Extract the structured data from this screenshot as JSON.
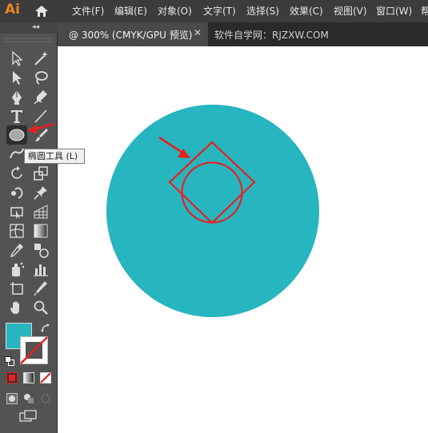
{
  "app": {
    "logo": "Ai",
    "home_icon": "home-icon",
    "menu": [
      "文件(F)",
      "编辑(E)",
      "对象(O)",
      "文字(T)",
      "选择(S)",
      "效果(C)",
      "视图(V)",
      "窗口(W)",
      "帮"
    ]
  },
  "tabs": {
    "active_title": "@ 300% (CMYK/GPU 预览)",
    "close_label": "✕",
    "inactive_title": "软件自学网：RJZXW.COM"
  },
  "toolbar": {
    "collapse_label": "◂◂",
    "tooltip": "椭圆工具 (L)",
    "tools": [
      "selection-tool",
      "magic-wand-tool",
      "direct-selection-tool",
      "lasso-tool",
      "pen-tool",
      "curvature-tool",
      "type-tool",
      "line-segment-tool",
      "ellipse-tool",
      "paintbrush-tool",
      "shaper-tool",
      "eraser-tool",
      "rotate-tool",
      "scale-tool",
      "puppet-warp-tool",
      "pin-tool",
      "free-transform-tool",
      "perspective-grid-tool",
      "mesh-tool",
      "gradient-tool",
      "eyedropper-tool",
      "blend-tool",
      "symbol-sprayer-tool",
      "column-graph-tool",
      "artboard-tool",
      "slice-tool",
      "hand-tool",
      "zoom-tool"
    ],
    "active_tool": "ellipse-tool"
  },
  "colors": {
    "fill": "#27b5c0",
    "stroke": "none",
    "annotation": "#e8201e",
    "menubar": "#3c3c3c",
    "toolbar": "#535353",
    "canvas": "#ffffff"
  }
}
